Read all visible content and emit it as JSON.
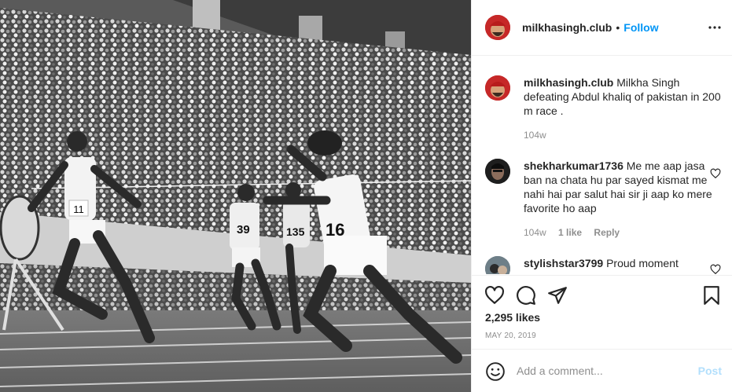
{
  "post": {
    "username": "milkhasingh.club",
    "dot": "•",
    "follow_label": "Follow",
    "photo_bibs": [
      "11",
      "39",
      "135",
      "16"
    ]
  },
  "caption": {
    "username": "milkhasingh.club",
    "text": "Milkha Singh defeating Abdul khaliq of pakistan in 200 m race .",
    "age": "104w"
  },
  "comments": [
    {
      "username": "shekharkumar1736",
      "text": "Me me aap jasa ban na chata hu par sayed kismat me nahi hai par salut hai sir ji aap ko mere favorite ho aap",
      "age": "104w",
      "likes": "1 like",
      "reply": "Reply"
    },
    {
      "username": "stylishstar3799",
      "text": "Proud moment"
    }
  ],
  "actions": {
    "likes": "2,295 likes",
    "date": "MAY 20, 2019"
  },
  "add_comment": {
    "placeholder": "Add a comment...",
    "post_label": "Post"
  },
  "colors": {
    "link": "#0095f6",
    "muted": "#8e8e8e",
    "post_disabled": "#b2dffc"
  },
  "icons": [
    "more-icon",
    "heart-icon",
    "comment-icon",
    "share-icon",
    "bookmark-icon",
    "smile-icon"
  ]
}
